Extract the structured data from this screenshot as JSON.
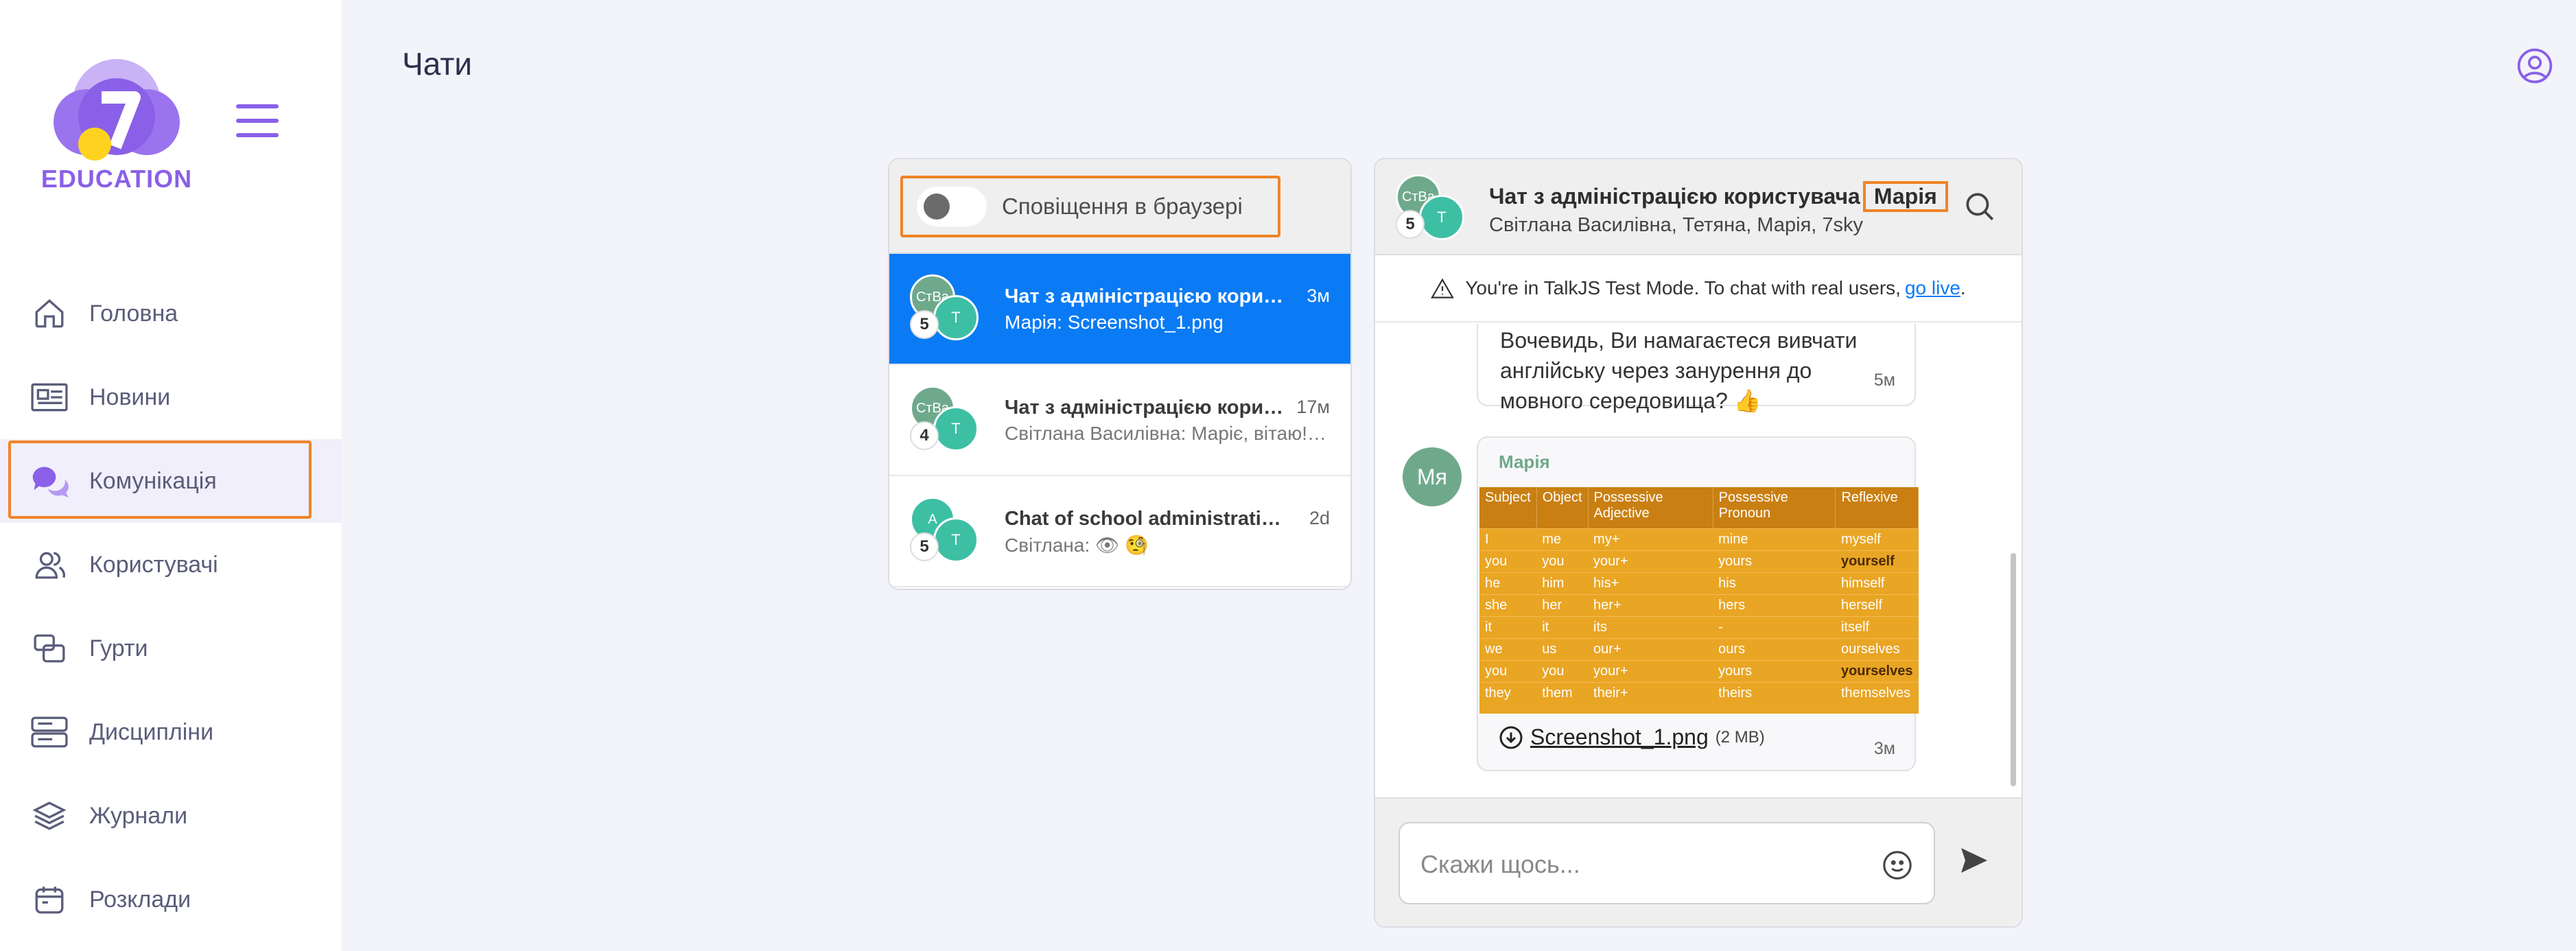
{
  "sidebar": {
    "logo_text": "EDUCATION",
    "items": [
      {
        "label": "Головна",
        "icon": "home-icon"
      },
      {
        "label": "Новини",
        "icon": "newspaper-icon"
      },
      {
        "label": "Комунікація",
        "icon": "chat-bubbles-icon",
        "active": true
      },
      {
        "label": "Користувачі",
        "icon": "users-icon"
      },
      {
        "label": "Гурти",
        "icon": "groups-icon"
      },
      {
        "label": "Дисципліни",
        "icon": "disciplines-icon"
      },
      {
        "label": "Журнали",
        "icon": "layers-icon"
      },
      {
        "label": "Розклади",
        "icon": "calendar-icon"
      }
    ]
  },
  "header": {
    "title": "Чати"
  },
  "notifications": {
    "label": "Сповіщення в браузері",
    "enabled": false
  },
  "conversations": [
    {
      "title": "Чат з адміністрацією користувача Марія",
      "time": "3м",
      "message": "Марія: Screenshot_1.png",
      "avatar1": "СтВа",
      "avatar2": "Т",
      "count": "5",
      "selected": true
    },
    {
      "title": "Чат з адміністрацією користувача",
      "time": "17м",
      "message": "Світлана Василівна: Маріє, вітаю! Очевидно",
      "avatar1": "СтВа",
      "avatar2": "Т",
      "count": "4",
      "selected": false
    },
    {
      "title": "Chat of school administration E...",
      "time": "2d",
      "message": "Світлана: 👁 🧐",
      "avatar1": "А",
      "avatar2": "Т",
      "count": "5",
      "selected": false
    }
  ],
  "chat": {
    "title_prefix": "Чат з адміністрацією користувача",
    "title_name": "Марія",
    "subtitle": "Світлана Василівна, Тетяна, Марія, 7sky",
    "avatar1": "СтВа",
    "avatar2": "Т",
    "count": "5",
    "banner_text": "You're in TalkJS Test Mode. To chat with real users,",
    "banner_link": "go live",
    "banner_end": ".",
    "message1_text": "Вочевидь, Ви намагаєтеся вивчати англійську через занурення до мовного середовища? 👍",
    "message1_time": "5м",
    "message2_sender": "Марія",
    "message2_avatar": "Мя",
    "message2_file": "Screenshot_1.png",
    "message2_size": "(2 MB)",
    "message2_time": "3м",
    "composer_placeholder": "Скажи щось..."
  },
  "grammar_table": {
    "headers": [
      "Subject",
      "Object",
      "Possessive Adjective",
      "Possessive Pronoun",
      "Reflexive"
    ],
    "rows": [
      [
        "I",
        "me",
        "my+",
        "mine",
        "myself"
      ],
      [
        "you",
        "you",
        "your+",
        "yours",
        "yourself"
      ],
      [
        "he",
        "him",
        "his+",
        "his",
        "himself"
      ],
      [
        "she",
        "her",
        "her+",
        "hers",
        "herself"
      ],
      [
        "it",
        "it",
        "its",
        "-",
        "itself"
      ],
      [
        "we",
        "us",
        "our+",
        "ours",
        "ourselves"
      ],
      [
        "you",
        "you",
        "your+",
        "yours",
        "yourselves"
      ],
      [
        "they",
        "them",
        "their+",
        "theirs",
        "themselves"
      ]
    ]
  },
  "colors": {
    "accent": "#8a60e8",
    "selected": "#0a7bf5",
    "highlight": "#f08426"
  }
}
